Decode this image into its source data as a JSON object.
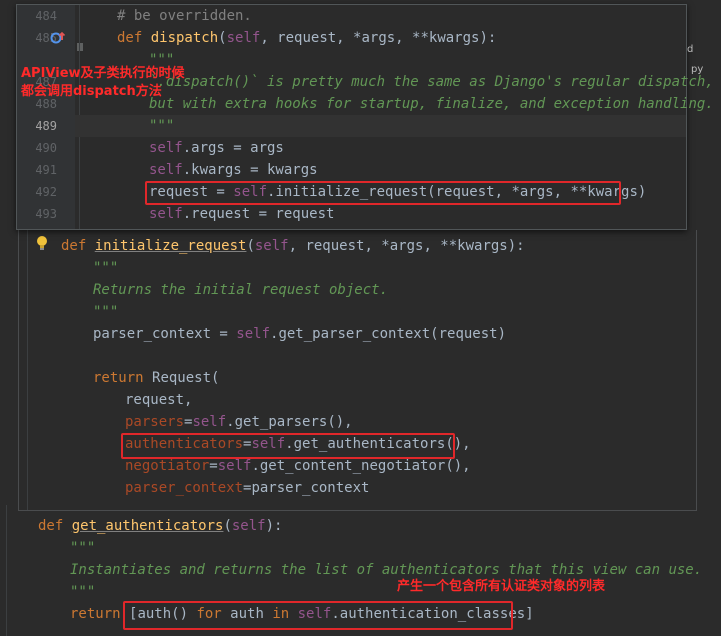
{
  "top_popup": {
    "line_numbers": [
      "484",
      "485",
      "487",
      "488",
      "489",
      "490",
      "491",
      "492",
      "493"
    ],
    "lines": {
      "l484": "# be overridden.",
      "l485_def": "def ",
      "l485_name": "dispatch",
      "l485_open": "(",
      "l485_self": "self",
      "l485_rest": ", request, *args, **kwargs):",
      "l486": "\"\"\"",
      "l487": "`.dispatch()` is pretty much the same as Django's regular dispatch,",
      "l488": "but with extra hooks for startup, finalize, and exception handling.",
      "l489": "\"\"\"",
      "l490_self": "self",
      "l490_rest": ".args = args",
      "l491_self": "self",
      "l491_rest": ".kwargs = kwargs",
      "l492_a": "request = ",
      "l492_self": "self",
      "l492_b": ".initialize_request(request, *args, **kwargs)",
      "l493_self": "self",
      "l493_rest": ".request = request"
    }
  },
  "middle_editor": {
    "def_kw": "def ",
    "name": "initialize_request",
    "open": "(",
    "self": "self",
    "params_rest": ", request, *args, **kwargs):",
    "doc_open": "\"\"\"",
    "doc_text": "Returns the initial request object.",
    "doc_close": "\"\"\"",
    "parser_a": "parser_context = ",
    "parser_self": "self",
    "parser_b": ".get_parser_context(request)",
    "return_kw": "return ",
    "return_rest": "Request(",
    "arg_request": "request,",
    "arg_parsers_k": "parsers",
    "arg_parsers_eq": "=",
    "arg_parsers_self": "self",
    "arg_parsers_v": ".get_parsers(),",
    "arg_auth_k": "authenticators",
    "arg_auth_eq": "=",
    "arg_auth_self": "self",
    "arg_auth_v": ".get_authenticators(),",
    "arg_neg_k": "negotiator",
    "arg_neg_eq": "=",
    "arg_neg_self": "self",
    "arg_neg_v": ".get_content_negotiator(),",
    "arg_pc_k": "parser_context",
    "arg_pc_eq": "=",
    "arg_pc_v": "parser_context"
  },
  "bottom_editor": {
    "def_kw": "def ",
    "name": "get_authenticators",
    "open": "(",
    "self": "self",
    "close": "):",
    "doc_open": "\"\"\"",
    "doc_text": "Instantiates and returns the list of authenticators that this view can use.",
    "doc_close": "\"\"\"",
    "return_kw": "return ",
    "list_open": "[auth() ",
    "for_kw": "for ",
    "auth_word": "auth ",
    "in_kw": "in ",
    "list_self": "self",
    "list_rest": ".authentication_classes]"
  },
  "annotations": {
    "dispatch_note_line1": "APIView及子类执行的时候",
    "dispatch_note_line2": "都会调用dispatch方法",
    "list_note": "产生一个包含所有认证类对象的列表"
  },
  "edge_fragments": {
    "frag_d": "d",
    "frag_py": "py"
  },
  "colors": {
    "background": "#2b2b2b",
    "keyword": "#cc7832",
    "function_name": "#ffc66d",
    "self": "#94558d",
    "docstring": "#629755",
    "kwarg": "#aa4926",
    "annotation_red": "#ff2a2a",
    "highlight_box": "#e0272a"
  },
  "icons": [
    "lightbulb-icon",
    "override-method-icon",
    "breakpoint-marker-icon"
  ]
}
